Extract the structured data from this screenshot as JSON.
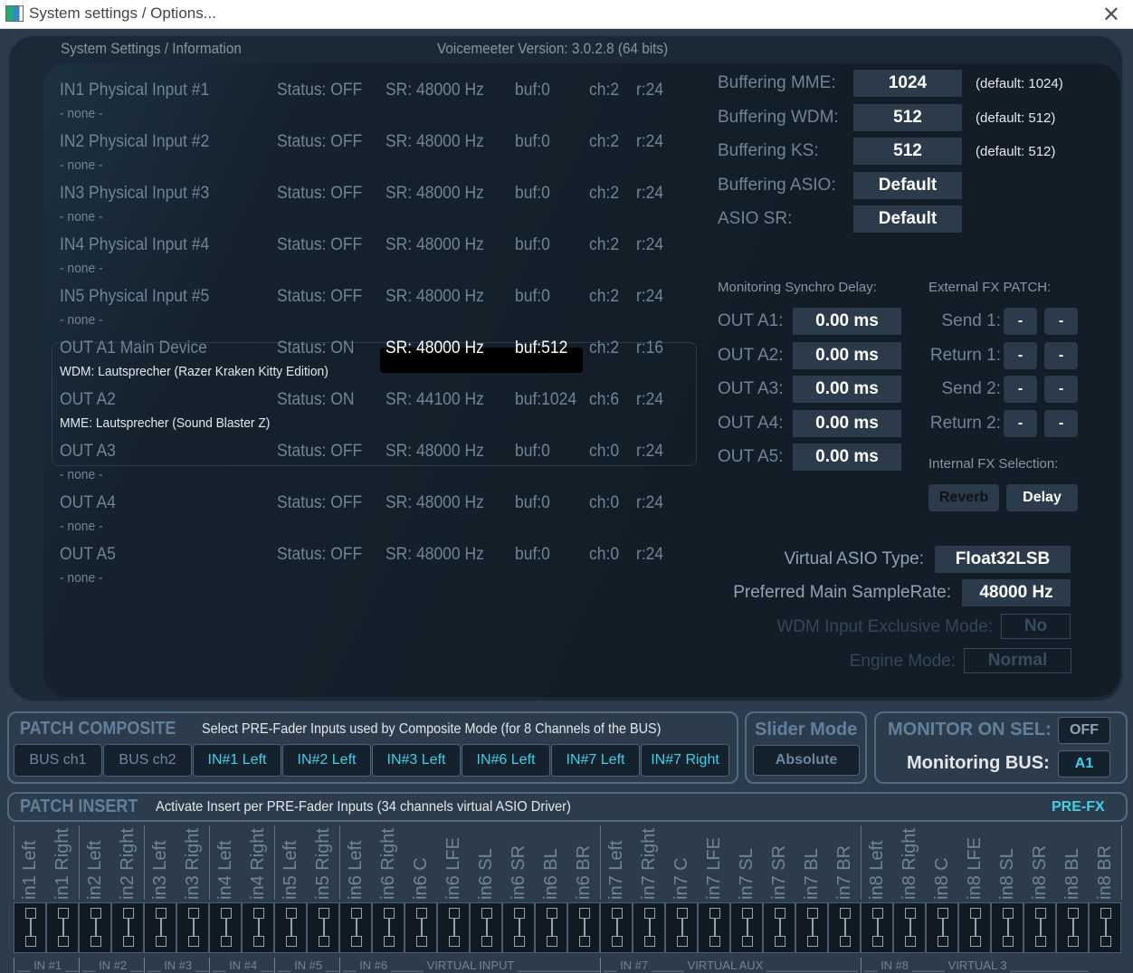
{
  "window": {
    "title": "System settings / Options...",
    "close": "✕"
  },
  "header": {
    "title": "System Settings / Information",
    "version": "Voicemeeter Version: 3.0.2.8 (64 bits)"
  },
  "devices": [
    {
      "name": "IN1 Physical Input #1",
      "status": "Status: OFF",
      "sr": "SR: 48000 Hz",
      "buf": "buf:0",
      "ch": "ch:2",
      "r": "r:24",
      "device": "- none -"
    },
    {
      "name": "IN2 Physical Input #2",
      "status": "Status: OFF",
      "sr": "SR: 48000 Hz",
      "buf": "buf:0",
      "ch": "ch:2",
      "r": "r:24",
      "device": "- none -"
    },
    {
      "name": "IN3 Physical Input #3",
      "status": "Status: OFF",
      "sr": "SR: 48000 Hz",
      "buf": "buf:0",
      "ch": "ch:2",
      "r": "r:24",
      "device": "- none -"
    },
    {
      "name": "IN4 Physical Input #4",
      "status": "Status: OFF",
      "sr": "SR: 48000 Hz",
      "buf": "buf:0",
      "ch": "ch:2",
      "r": "r:24",
      "device": "- none -"
    },
    {
      "name": "IN5 Physical Input #5",
      "status": "Status: OFF",
      "sr": "SR: 48000 Hz",
      "buf": "buf:0",
      "ch": "ch:2",
      "r": "r:24",
      "device": "- none -"
    },
    {
      "name": "OUT A1 Main Device",
      "status": "Status: ON",
      "sr": "SR: 48000 Hz",
      "buf": "buf:512",
      "ch": "ch:2",
      "r": "r:16",
      "device": "WDM: Lautsprecher (Razer Kraken Kitty Edition)"
    },
    {
      "name": "OUT A2",
      "status": "Status: ON",
      "sr": "SR: 44100 Hz",
      "buf": "buf:1024",
      "ch": "ch:6",
      "r": "r:24",
      "device": "MME: Lautsprecher (Sound Blaster Z)"
    },
    {
      "name": "OUT A3",
      "status": "Status: OFF",
      "sr": "SR: 48000 Hz",
      "buf": "buf:0",
      "ch": "ch:0",
      "r": "r:24",
      "device": "- none -"
    },
    {
      "name": "OUT A4",
      "status": "Status: OFF",
      "sr": "SR: 48000 Hz",
      "buf": "buf:0",
      "ch": "ch:0",
      "r": "r:24",
      "device": "- none -"
    },
    {
      "name": "OUT A5",
      "status": "Status: OFF",
      "sr": "SR: 48000 Hz",
      "buf": "buf:0",
      "ch": "ch:0",
      "r": "r:24",
      "device": "- none -"
    }
  ],
  "buffering": [
    {
      "label": "Buffering MME:",
      "value": "1024",
      "default": "(default: 1024)"
    },
    {
      "label": "Buffering WDM:",
      "value": "512",
      "default": "(default: 512)"
    },
    {
      "label": "Buffering KS:",
      "value": "512",
      "default": "(default: 512)"
    },
    {
      "label": "Buffering ASIO:",
      "value": "Default",
      "default": ""
    },
    {
      "label": "ASIO SR:",
      "value": "Default",
      "default": ""
    }
  ],
  "sync": {
    "title": "Monitoring Synchro Delay:",
    "rows": [
      {
        "label": "OUT A1:",
        "value": "0.00 ms"
      },
      {
        "label": "OUT A2:",
        "value": "0.00 ms"
      },
      {
        "label": "OUT A3:",
        "value": "0.00 ms"
      },
      {
        "label": "OUT A4:",
        "value": "0.00 ms"
      },
      {
        "label": "OUT A5:",
        "value": "0.00 ms"
      }
    ]
  },
  "extfx": {
    "title": "External FX PATCH:",
    "rows": [
      {
        "label": "Send 1:",
        "a": "-",
        "b": "-"
      },
      {
        "label": "Return 1:",
        "a": "-",
        "b": "-"
      },
      {
        "label": "Send 2:",
        "a": "-",
        "b": "-"
      },
      {
        "label": "Return 2:",
        "a": "-",
        "b": "-"
      }
    ]
  },
  "intfx": {
    "title": "Internal FX Selection:",
    "reverb": "Reverb",
    "delay": "Delay",
    "selected": "Delay"
  },
  "options": {
    "asio_type_label": "Virtual ASIO Type:",
    "asio_type": "Float32LSB",
    "sr_label": "Preferred Main SampleRate:",
    "sr": "48000 Hz",
    "wdm_excl_label": "WDM Input Exclusive Mode:",
    "wdm_excl": "No",
    "engine_label": "Engine Mode:",
    "engine": "Normal"
  },
  "composite": {
    "title": "PATCH COMPOSITE",
    "desc": "Select PRE-Fader Inputs used by Composite Mode (for 8 Channels of the BUS)",
    "buttons": [
      {
        "label": "BUS ch1",
        "active": false
      },
      {
        "label": "BUS ch2",
        "active": false
      },
      {
        "label": "IN#1 Left",
        "active": true
      },
      {
        "label": "IN#2 Left",
        "active": true
      },
      {
        "label": "IN#3 Left",
        "active": true
      },
      {
        "label": "IN#6 Left",
        "active": true
      },
      {
        "label": "IN#7 Left",
        "active": true
      },
      {
        "label": "IN#7 Right",
        "active": true
      }
    ]
  },
  "slider": {
    "title": "Slider Mode",
    "value": "Absolute"
  },
  "monitor": {
    "label": "MONITOR ON SEL:",
    "value": "OFF",
    "bus_label": "Monitoring BUS:",
    "bus": "A1"
  },
  "insert": {
    "title": "PATCH INSERT",
    "desc": "Activate Insert per PRE-Fader Inputs (34 channels virtual ASIO Driver)",
    "mode": "PRE-FX",
    "channels": [
      "in1 Left",
      "in1 Right",
      "in2 Left",
      "in2 Right",
      "in3 Left",
      "in3 Right",
      "in4 Left",
      "in4 Right",
      "in5 Left",
      "in5 Right",
      "in6 Left",
      "in6 Right",
      "in6 C",
      "in6 LFE",
      "in6 SL",
      "in6 SR",
      "in6 BL",
      "in6 BR",
      "in7 Left",
      "in7 Right",
      "in7 C",
      "in7 LFE",
      "in7 SL",
      "in7 SR",
      "in7 BL",
      "in7 BR",
      "in8 Left",
      "in8 Right",
      "in8 C",
      "in8 LFE",
      "in8 SL",
      "in8 SR",
      "in8 BL",
      "in8 BR"
    ],
    "groups": [
      {
        "label": "__ IN #1 __",
        "n": 2
      },
      {
        "label": "__ IN #2 __",
        "n": 2
      },
      {
        "label": "__ IN #3 __",
        "n": 2
      },
      {
        "label": "__ IN #4 __",
        "n": 2
      },
      {
        "label": "__ IN #5 __",
        "n": 2
      },
      {
        "label": "__ IN #6 _____ VIRTUAL INPUT ______________",
        "n": 8
      },
      {
        "label": "__ IN #7 _____ VIRTUAL AUX ______________",
        "n": 8
      },
      {
        "label": "__ IN #8 _____     VIRTUAL 3 ____________",
        "n": 8
      }
    ]
  },
  "colors": {
    "accent": "#3fd0e8",
    "text": "#8fa3b5",
    "panel": "#121d27"
  }
}
